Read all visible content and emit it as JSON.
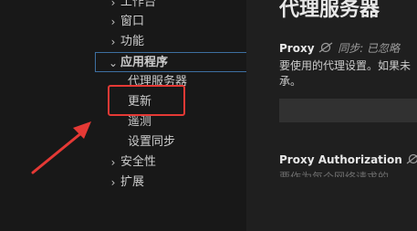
{
  "tree": {
    "items": [
      {
        "label": "工作台",
        "chevron": "›"
      },
      {
        "label": "窗口",
        "chevron": "›"
      },
      {
        "label": "功能",
        "chevron": "›"
      },
      {
        "label": "应用程序",
        "chevron": "⌄"
      },
      {
        "label": "代理服务器"
      },
      {
        "label": "更新"
      },
      {
        "label": "遥测"
      },
      {
        "label": "设置同步"
      },
      {
        "label": "安全性",
        "chevron": "›"
      },
      {
        "label": "扩展",
        "chevron": "›"
      }
    ]
  },
  "content": {
    "page_title": "代理服务器",
    "proxy": {
      "name": "Proxy",
      "sync_status": "同步: 已忽略",
      "description_line1": "要使用的代理设置。如果未",
      "description_line2": "承。"
    },
    "proxy_auth": {
      "name": "Proxy Authorization",
      "description": "要作为每个网络请求的"
    }
  },
  "colors": {
    "highlight": "#e53935",
    "selection_border": "#3d6fa0"
  }
}
